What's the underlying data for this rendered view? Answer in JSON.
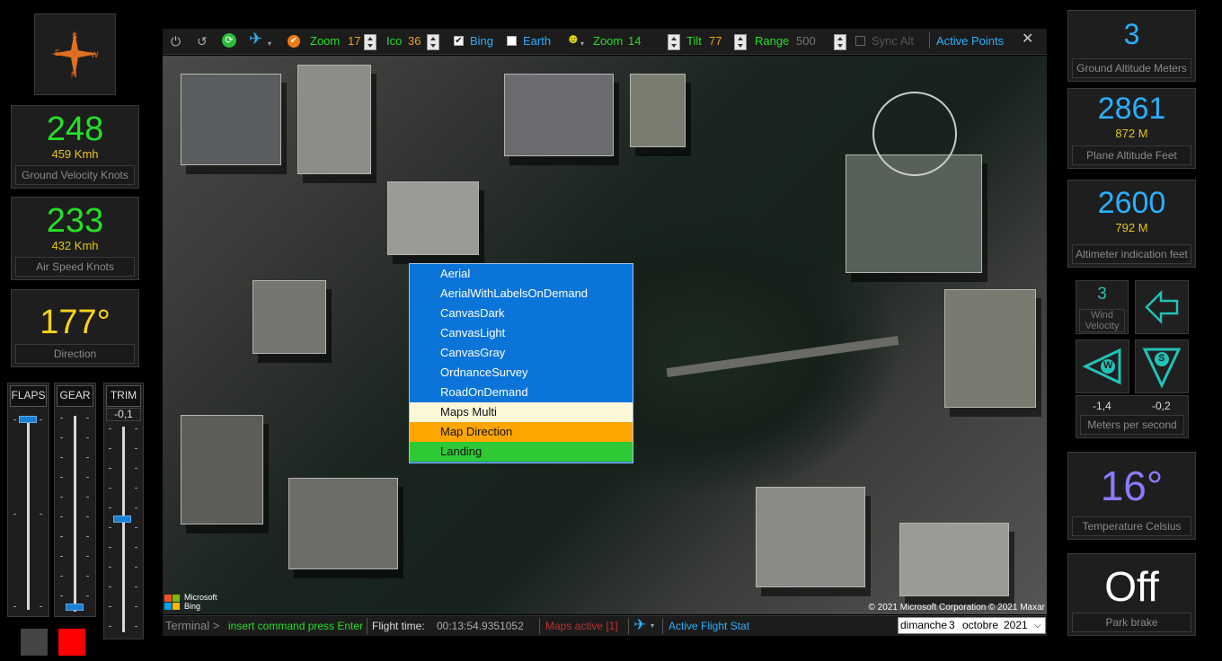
{
  "compass": {
    "n": "N",
    "s": "S",
    "e": "E",
    "w": "W"
  },
  "ground_velocity": {
    "value": "248",
    "sub": "459 Kmh",
    "caption": "Ground Velocity Knots"
  },
  "air_speed": {
    "value": "233",
    "sub": "432 Kmh",
    "caption": "Air Speed Knots"
  },
  "direction": {
    "value": "177°",
    "caption": "Direction"
  },
  "controls": {
    "flaps": "FLAPS",
    "gear": "GEAR",
    "trim": "TRIM",
    "trim_value": "-0,1"
  },
  "toolbar": {
    "zoom_label": "Zoom",
    "zoom_value": "17",
    "ico_label": "Ico",
    "ico_value": "36",
    "bing": "Bing",
    "earth": "Earth",
    "zoom2_label": "Zoom",
    "zoom2_value": "14",
    "tilt_label": "Tilt",
    "tilt_value": "77",
    "range_label": "Range",
    "range_value": "500",
    "sync_alt": "Sync Alt",
    "active_points": "Active Points",
    "close": "✕"
  },
  "map": {
    "attribution": "© 2021 Microsoft Corporation © 2021 Maxar",
    "logo_line1": "Microsoft",
    "logo_line2": "Bing"
  },
  "menu": {
    "items": [
      "Aerial",
      "AerialWithLabelsOnDemand",
      "CanvasDark",
      "CanvasLight",
      "CanvasGray",
      "OrdnanceSurvey",
      "RoadOnDemand",
      "Maps Multi",
      "Map Direction",
      "Landing"
    ]
  },
  "status": {
    "terminal": "Terminal >",
    "command": "insert command press Enter",
    "flight_time_label": "Flight time:",
    "flight_time": "00:13:54.9351052",
    "maps_active": "Maps active [1]",
    "active_flight_stat": "Active Flight Stat",
    "date_day": "dimanche",
    "date_num": "3",
    "date_month": "octobre",
    "date_year": "2021"
  },
  "ground_altitude": {
    "value": "3",
    "caption": "Ground Altitude Meters"
  },
  "plane_altitude": {
    "value": "2861",
    "sub": "872 M",
    "caption": "Plane Altitude Feet"
  },
  "altimeter": {
    "value": "2600",
    "sub": "792 M",
    "caption": "Altimeter indication feet"
  },
  "wind": {
    "velocity": "3",
    "velocity_caption": "Wind Velocity",
    "w_letter": "W",
    "s_letter": "S",
    "w_value": "-1,4",
    "s_value": "-0,2",
    "caption": "Meters per second"
  },
  "temperature": {
    "value": "16°",
    "caption": "Temperature Celsius"
  },
  "park_brake": {
    "value": "Off",
    "caption": "Park brake"
  },
  "colors": {
    "accent_green": "#25e025",
    "accent_blue": "#2ab0ff",
    "accent_yellow": "#ffd21a",
    "menu_blue": "#0b74d8",
    "menu_cream": "#fbf8d8",
    "menu_orange": "#ffa500",
    "menu_green": "#2ec934",
    "wind_teal": "#22c2b8"
  }
}
